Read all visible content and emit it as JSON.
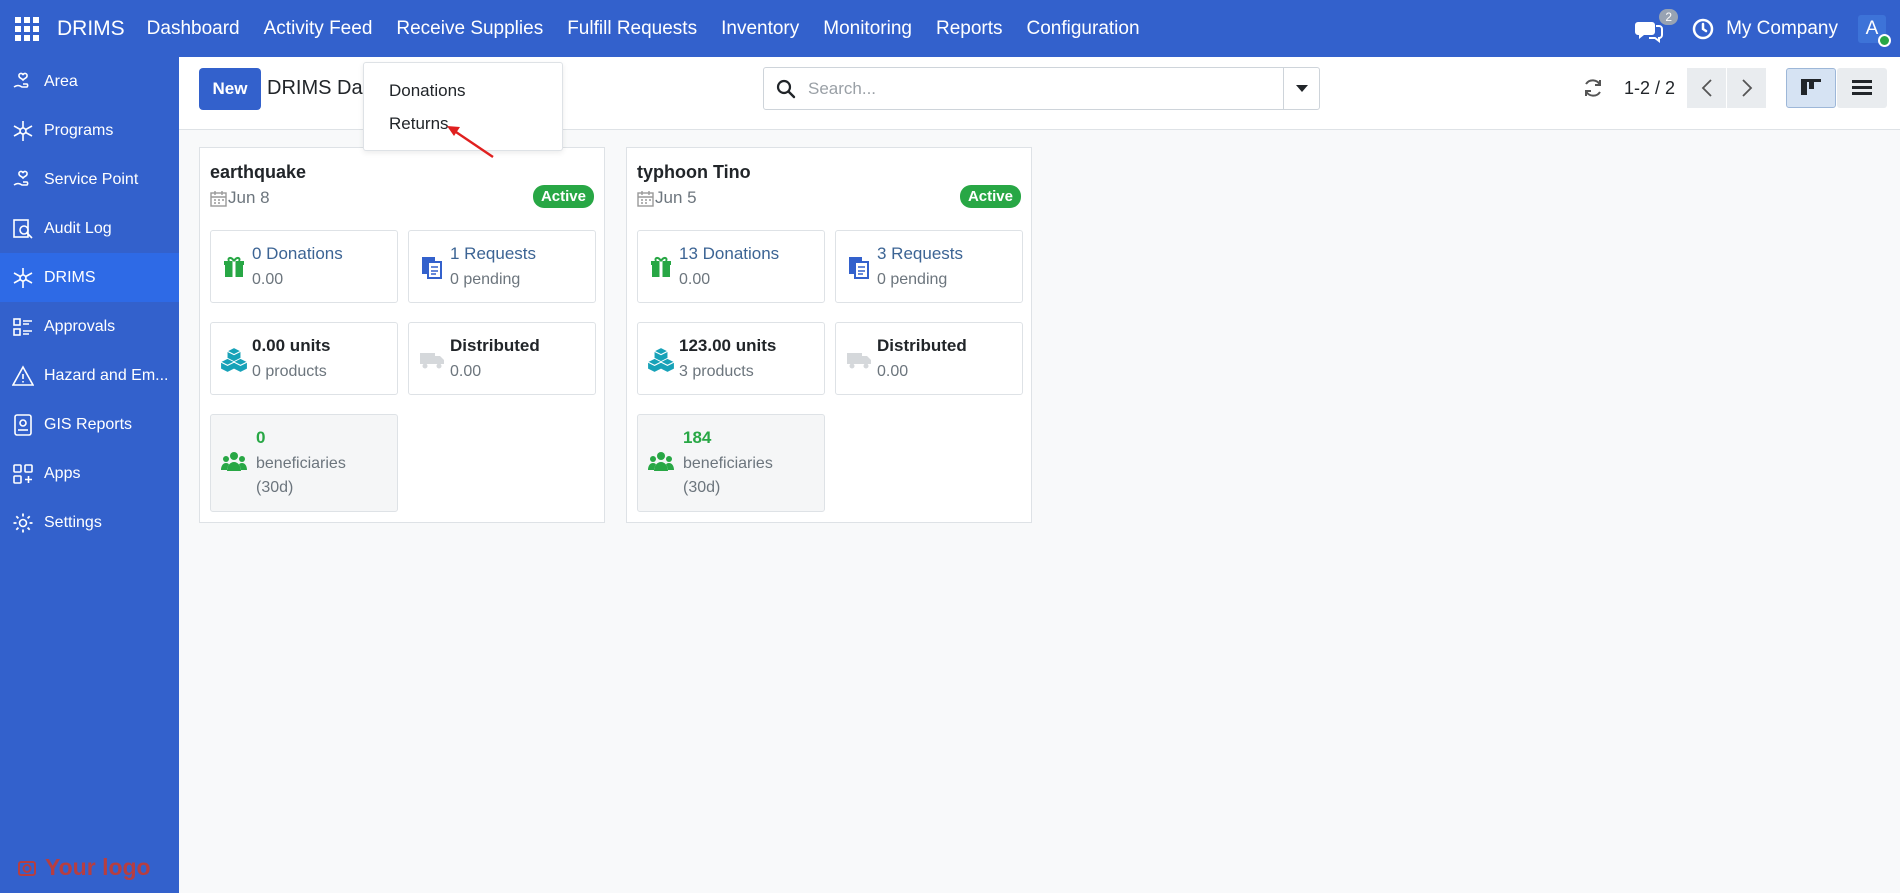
{
  "topbar": {
    "brand": "DRIMS",
    "nav": [
      "Dashboard",
      "Activity Feed",
      "Receive Supplies",
      "Fulfill Requests",
      "Inventory",
      "Monitoring",
      "Reports",
      "Configuration"
    ],
    "chat_count": "2",
    "company": "My Company",
    "avatar_letter": "A"
  },
  "sidebar": {
    "items": [
      {
        "label": "Area",
        "icon": "hand-heart-icon"
      },
      {
        "label": "Programs",
        "icon": "snowflake-icon"
      },
      {
        "label": "Service Point",
        "icon": "hand-heart-icon"
      },
      {
        "label": "Audit Log",
        "icon": "search-document-icon"
      },
      {
        "label": "DRIMS",
        "icon": "snowflake-icon"
      },
      {
        "label": "Approvals",
        "icon": "list-check-icon"
      },
      {
        "label": "Hazard and Em...",
        "icon": "warning-icon"
      },
      {
        "label": "GIS Reports",
        "icon": "map-report-icon"
      },
      {
        "label": "Apps",
        "icon": "apps-plus-icon"
      },
      {
        "label": "Settings",
        "icon": "gear-icon"
      }
    ],
    "active_index": 4,
    "logo_text": "Your logo"
  },
  "control": {
    "new_label": "New",
    "breadcrumb": "DRIMS Das",
    "search_placeholder": "Search...",
    "pager": "1-2 / 2"
  },
  "dropdown": {
    "items": [
      "Donations",
      "Returns"
    ]
  },
  "cards": [
    {
      "title": "earthquake",
      "date": "Jun 8",
      "status": "Active",
      "donations": "0 Donations",
      "donations_amount": "0.00",
      "requests": "1 Requests",
      "requests_pending": "0 pending",
      "units": "0.00 units",
      "products": "0 products",
      "distributed": "Distributed",
      "distributed_amount": "0.00",
      "beneficiaries": "0",
      "beneficiaries_label": "beneficiaries",
      "beneficiaries_period": "(30d)"
    },
    {
      "title": "typhoon Tino",
      "date": "Jun 5",
      "status": "Active",
      "donations": "13 Donations",
      "donations_amount": "0.00",
      "requests": "3 Requests",
      "requests_pending": "0 pending",
      "units": "123.00 units",
      "products": "3 products",
      "distributed": "Distributed",
      "distributed_amount": "0.00",
      "beneficiaries": "184",
      "beneficiaries_label": "beneficiaries",
      "beneficiaries_period": "(30d)"
    }
  ],
  "colors": {
    "primary": "#3361cc",
    "active_sidebar": "#2e6ae6",
    "success": "#28a745",
    "link": "#3c6494",
    "annotation_arrow": "#e0201f"
  }
}
